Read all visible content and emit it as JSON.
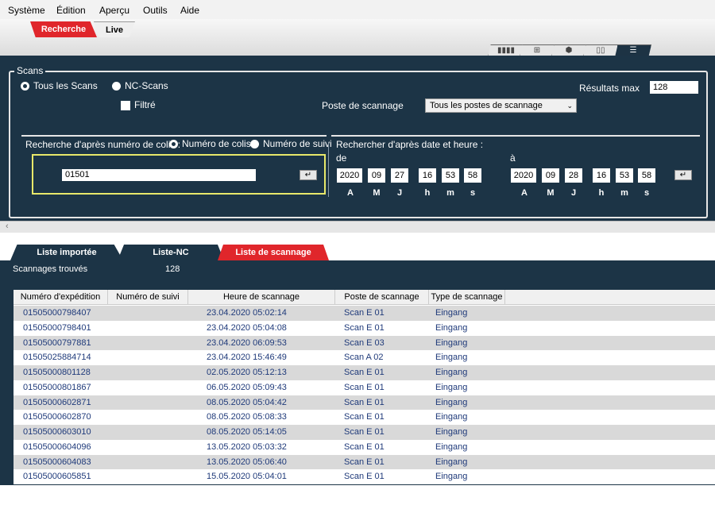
{
  "menu": [
    "Système",
    "Édition",
    "Aperçu",
    "Outils",
    "Aide"
  ],
  "top_tabs": {
    "active": "Recherche",
    "other": "Live"
  },
  "view_tabs": [
    "barcode-icon",
    "grid-icon",
    "package-icon",
    "map-icon",
    "list-icon"
  ],
  "scans": {
    "legend": "Scans",
    "radio_all": "Tous les Scans",
    "radio_nc": "NC-Scans",
    "filtered": "Filtré",
    "results_max_label": "Résultats max",
    "results_max_value": "128",
    "station_label": "Poste de scannage",
    "station_value": "Tous les postes de scannage"
  },
  "parcel_search": {
    "label": "Recherche d'après numéro de colis :",
    "opt_parcel": "Numéro de colis",
    "opt_tracking": "Numéro de suivi",
    "value": "01501"
  },
  "date_search": {
    "label": "Rechercher d'après date et heure :",
    "from_label": "de",
    "to_label": "à",
    "from": [
      "2020",
      "09",
      "27",
      "16",
      "53",
      "58"
    ],
    "to": [
      "2020",
      "09",
      "28",
      "16",
      "53",
      "58"
    ],
    "units": [
      "A",
      "M",
      "J",
      "h",
      "m",
      "s"
    ]
  },
  "list_tabs": [
    "Liste importée",
    "Liste-NC",
    "Liste de scannage"
  ],
  "found": {
    "label": "Scannages trouvés",
    "count": "128"
  },
  "table": {
    "headers": [
      "Numéro d'expédition",
      "Numéro de suivi",
      "Heure de scannage",
      "Poste de scannage",
      "Type de scannage"
    ],
    "rows": [
      [
        "01505000798407",
        "",
        "23.04.2020 05:02:14",
        "Scan E 01",
        "Eingang"
      ],
      [
        "01505000798401",
        "",
        "23.04.2020 05:04:08",
        "Scan E 01",
        "Eingang"
      ],
      [
        "01505000797881",
        "",
        "23.04.2020 06:09:53",
        "Scan E 03",
        "Eingang"
      ],
      [
        "01505025884714",
        "",
        "23.04.2020 15:46:49",
        "Scan A 02",
        "Eingang"
      ],
      [
        "01505000801128",
        "",
        "02.05.2020 05:12:13",
        "Scan E 01",
        "Eingang"
      ],
      [
        "01505000801867",
        "",
        "06.05.2020 05:09:43",
        "Scan E 01",
        "Eingang"
      ],
      [
        "01505000602871",
        "",
        "08.05.2020 05:04:42",
        "Scan E 01",
        "Eingang"
      ],
      [
        "01505000602870",
        "",
        "08.05.2020 05:08:33",
        "Scan E 01",
        "Eingang"
      ],
      [
        "01505000603010",
        "",
        "08.05.2020 05:14:05",
        "Scan E 01",
        "Eingang"
      ],
      [
        "01505000604096",
        "",
        "13.05.2020 05:03:32",
        "Scan E 01",
        "Eingang"
      ],
      [
        "01505000604083",
        "",
        "13.05.2020 05:06:40",
        "Scan E 01",
        "Eingang"
      ],
      [
        "01505000605851",
        "",
        "15.05.2020 05:04:01",
        "Scan E 01",
        "Eingang"
      ]
    ]
  },
  "colors": {
    "panel": "#1c3446",
    "accent": "#e0262b",
    "highlight": "#e8e86a",
    "link_text": "#1f3a7a"
  }
}
